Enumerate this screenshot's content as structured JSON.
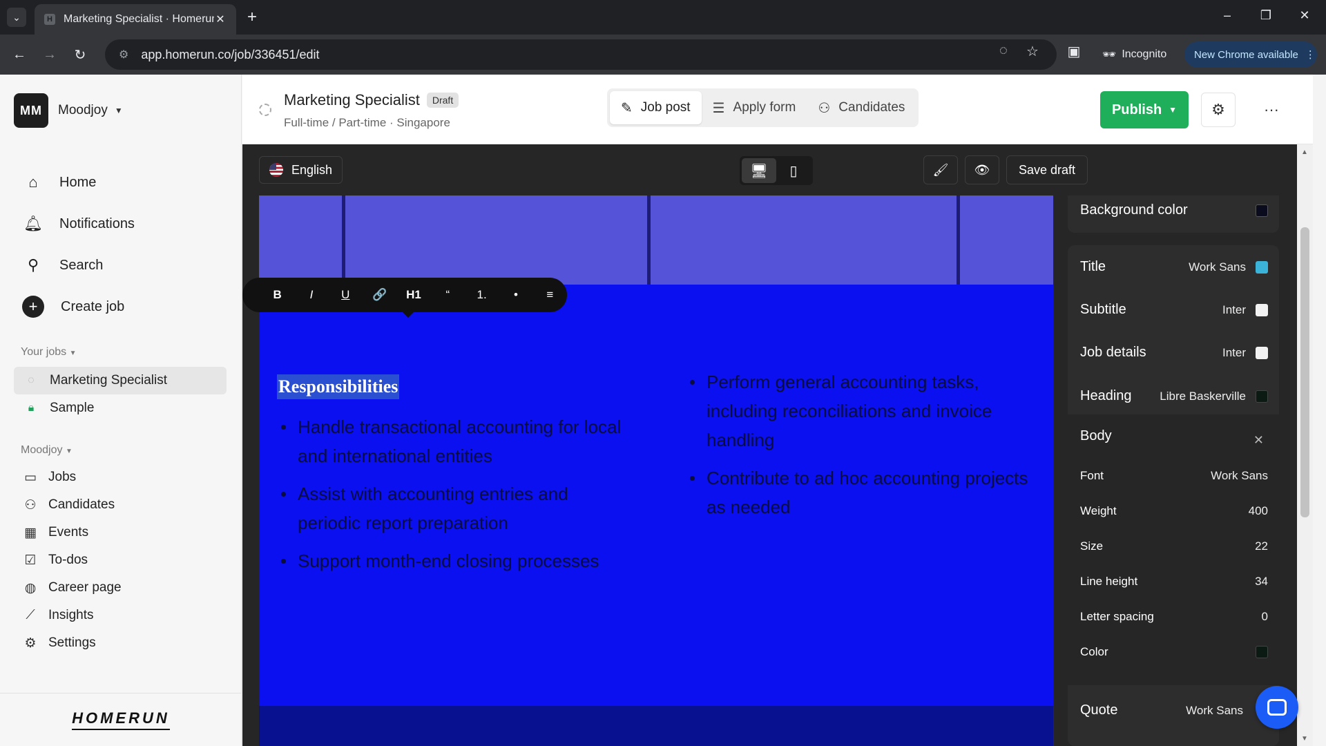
{
  "browser": {
    "tab_title": "Marketing Specialist · Homerun",
    "url": "app.homerun.co/job/336451/edit",
    "incognito_label": "Incognito",
    "update_label": "New Chrome available"
  },
  "sidebar": {
    "org_initials": "MM",
    "org_name": "Moodjoy",
    "nav": [
      {
        "label": "Home",
        "icon": "home-icon"
      },
      {
        "label": "Notifications",
        "icon": "bell-icon"
      },
      {
        "label": "Search",
        "icon": "search-icon"
      },
      {
        "label": "Create job",
        "icon": "plus-icon"
      }
    ],
    "your_jobs_label": "Your jobs",
    "jobs": [
      {
        "label": "Marketing Specialist",
        "active": true
      },
      {
        "label": "Sample",
        "active": false
      }
    ],
    "org_section_label": "Moodjoy",
    "org_nav": [
      {
        "label": "Jobs",
        "icon": "jobs-icon"
      },
      {
        "label": "Candidates",
        "icon": "candidates-icon"
      },
      {
        "label": "Events",
        "icon": "calendar-icon"
      },
      {
        "label": "To-dos",
        "icon": "checkbox-icon"
      },
      {
        "label": "Career page",
        "icon": "globe-icon"
      },
      {
        "label": "Insights",
        "icon": "chart-icon"
      },
      {
        "label": "Settings",
        "icon": "gear-icon"
      }
    ],
    "brand": "HOMERUN"
  },
  "header": {
    "job_title": "Marketing Specialist",
    "badge": "Draft",
    "subtitle": "Full-time / Part-time · Singapore",
    "tabs": [
      {
        "label": "Job post",
        "icon": "pencil-icon",
        "active": true
      },
      {
        "label": "Apply form",
        "icon": "list-icon",
        "active": false
      },
      {
        "label": "Candidates",
        "icon": "people-icon",
        "active": false
      }
    ],
    "publish_label": "Publish"
  },
  "editor": {
    "language": "English",
    "save_draft_label": "Save draft",
    "format_buttons": [
      "B",
      "I",
      "U",
      "🔗",
      "H1",
      "“",
      "1.",
      "•",
      "≡"
    ],
    "section_heading": "Responsibilities",
    "left_bullets": [
      "Handle transactional accounting for local and international entities",
      "Assist with accounting entries and periodic report preparation",
      "Support month-end closing processes"
    ],
    "right_bullets": [
      "Perform general accounting tasks, including reconciliations and invoice handling",
      "Contribute to ad hoc accounting projects as needed"
    ]
  },
  "style_panel": {
    "background_color_label": "Background color",
    "background_color": "#0b0b1e",
    "fonts": [
      {
        "label": "Title",
        "font": "Work Sans",
        "color": "#3bb3d8"
      },
      {
        "label": "Subtitle",
        "font": "Inter",
        "color": "#f2f2f2"
      },
      {
        "label": "Job details",
        "font": "Inter",
        "color": "#f2f2f2"
      },
      {
        "label": "Heading",
        "font": "Libre Baskerville",
        "color": "#0b1a12"
      }
    ],
    "body": {
      "label": "Body",
      "font_label": "Font",
      "font": "Work Sans",
      "weight_label": "Weight",
      "weight": "400",
      "size_label": "Size",
      "size": "22",
      "line_height_label": "Line height",
      "line_height": "34",
      "letter_spacing_label": "Letter spacing",
      "letter_spacing": "0",
      "color_label": "Color",
      "color": "#0b1a12"
    },
    "quote": {
      "label": "Quote",
      "font": "Work Sans"
    }
  }
}
